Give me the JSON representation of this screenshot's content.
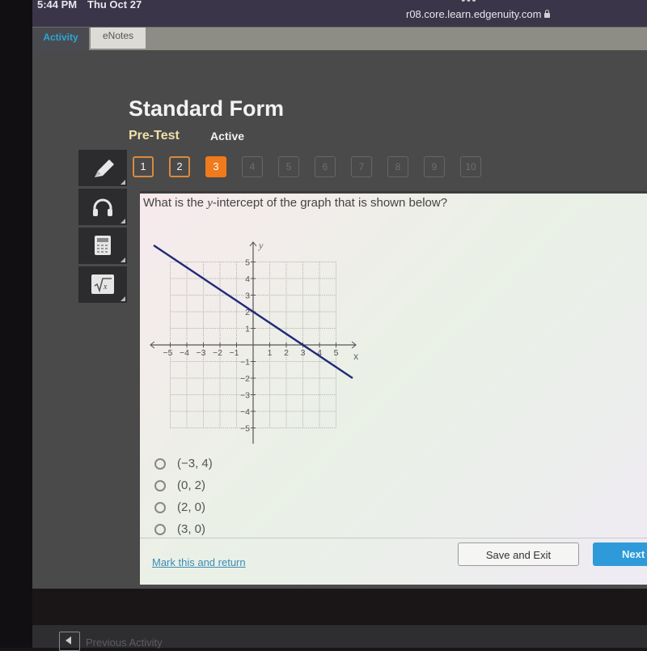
{
  "status_bar": {
    "time": "5:44 PM",
    "date": "Thu Oct 27",
    "url": "r08.core.learn.edgenuity.com",
    "more_icon": "ellipsis-icon",
    "lock_icon": "lock-icon"
  },
  "tabs": [
    {
      "label": "Activity",
      "active": true
    },
    {
      "label": "eNotes",
      "active": false
    }
  ],
  "header": {
    "title": "Standard Form",
    "subtitle": "Pre-Test",
    "status": "Active"
  },
  "question_nav": [
    {
      "label": "1",
      "state": "answered"
    },
    {
      "label": "2",
      "state": "answered"
    },
    {
      "label": "3",
      "state": "current"
    },
    {
      "label": "4",
      "state": "unvisited"
    },
    {
      "label": "5",
      "state": "unvisited"
    },
    {
      "label": "6",
      "state": "unvisited"
    },
    {
      "label": "7",
      "state": "unvisited"
    },
    {
      "label": "8",
      "state": "unvisited"
    },
    {
      "label": "9",
      "state": "unvisited"
    },
    {
      "label": "10",
      "state": "unvisited"
    }
  ],
  "tools": [
    "pencil-icon",
    "headphones-icon",
    "calculator-icon",
    "formula-sqrt-icon"
  ],
  "question": {
    "text_before": "What is the ",
    "variable": "y",
    "text_after": "-intercept of the graph that is shown below?"
  },
  "chart_data": {
    "type": "line",
    "title": "",
    "xlabel": "x",
    "ylabel": "y",
    "xlim": [
      -5,
      5
    ],
    "ylim": [
      -5,
      5
    ],
    "grid": true,
    "x_ticks": [
      -5,
      -4,
      -3,
      -2,
      -1,
      1,
      2,
      3,
      4,
      5
    ],
    "y_ticks": [
      -5,
      -4,
      -3,
      -2,
      -1,
      1,
      2,
      3,
      4,
      5
    ],
    "x_tick_labels": [
      "−5",
      "−4",
      "−3",
      "−2",
      "−1",
      "1",
      "2",
      "3",
      "4",
      "5"
    ],
    "y_tick_labels": [
      "−5",
      "−4",
      "−3",
      "−2",
      "−1",
      "1",
      "2",
      "3",
      "4",
      "5"
    ],
    "series": [
      {
        "name": "line",
        "color": "#1f2a78",
        "x": [
          -6,
          6
        ],
        "y": [
          6,
          -2
        ],
        "slope": -0.6667,
        "intercept": 2,
        "x_intercept": 3
      }
    ]
  },
  "answers": [
    {
      "label": "(−3, 4)",
      "selected": false
    },
    {
      "label": "(0, 2)",
      "selected": false
    },
    {
      "label": "(2, 0)",
      "selected": false
    },
    {
      "label": "(3, 0)",
      "selected": false
    }
  ],
  "actions": {
    "mark_label": "Mark this and return",
    "save_label": "Save and Exit",
    "next_label": "Next"
  },
  "footer": {
    "prev_label": "Previous Activity"
  },
  "colors": {
    "accent_orange": "#f07a1c",
    "link_blue": "#3a8bb6",
    "next_blue": "#2e9ad9",
    "activity_tab": "#2aa7d5",
    "line": "#1f2a78"
  }
}
